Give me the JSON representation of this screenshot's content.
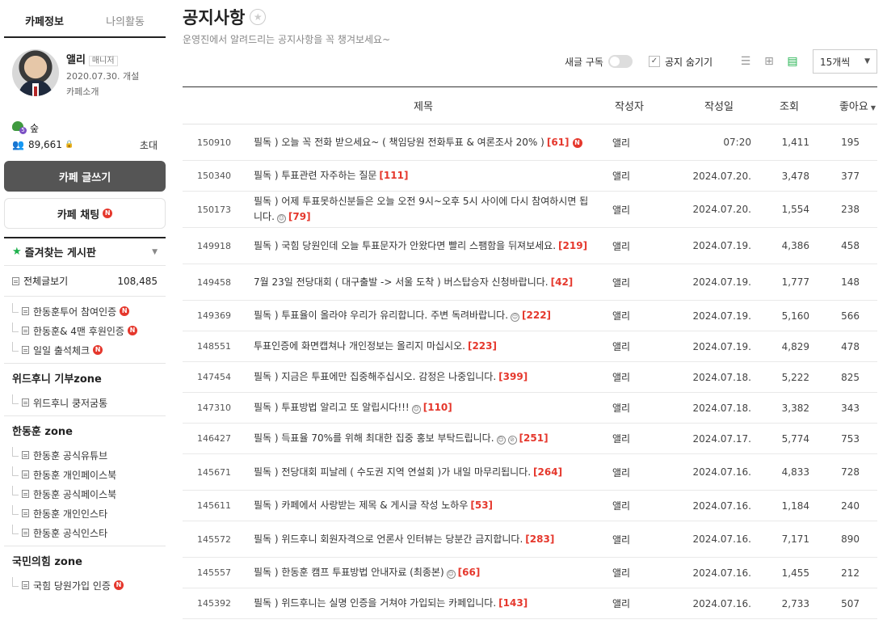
{
  "sidebar": {
    "tabs": [
      "카페정보",
      "나의활동"
    ],
    "profile": {
      "name": "앨리",
      "role": "매니저",
      "since": "2020.07.30. 개설",
      "intro": "카페소개"
    },
    "rank": "숲",
    "members": "89,661",
    "invite": "초대",
    "write_button": "카페 글쓰기",
    "chat_button": "카페 채팅",
    "new_badge": "N",
    "favorites_title": "즐겨찾는 게시판",
    "all_posts": {
      "label": "전체글보기",
      "count": "108,485"
    },
    "group1": [
      "한동훈투어 참여인증",
      "한동훈& 4맨 후원인증",
      "일일 출석체크"
    ],
    "zone1": {
      "title": "위드후니 기부zone",
      "items": [
        "위드후니 쿵저굼통"
      ]
    },
    "zone2": {
      "title": "한동훈 zone",
      "items": [
        "한동훈 공식유튜브",
        "한동훈 개인페이스북",
        "한동훈 공식페이스북",
        "한동훈 개인인스타",
        "한동훈 공식인스타"
      ]
    },
    "zone3": {
      "title": "국민의힘 zone",
      "items": [
        "국힘 당원가입 인증"
      ]
    }
  },
  "main": {
    "title": "공지사항",
    "title_star": "★",
    "description": "운영진에서 알려드리는 공지사항을 꼭 챙겨보세요~",
    "subscribe_label": "새글 구독",
    "hide_notice_label": "공지 숨기기",
    "per_page": "15개씩"
  },
  "table": {
    "headers": {
      "title": "제목",
      "author": "작성자",
      "date": "작성일",
      "views": "조회",
      "likes": "좋아요"
    },
    "rows": [
      {
        "id": "150910",
        "title": "필독 ) 오늘 꼭 전화 받으세요~ ( 책임당원 전화투표 & 여론조사 20% )",
        "comments": "[61]",
        "new": "N",
        "author": "앨리",
        "date": "07:20",
        "views": "1,411",
        "likes": "195"
      },
      {
        "id": "150340",
        "title": "필독 ) 투표관련 자주하는 질문",
        "comments": "[111]",
        "author": "앨리",
        "date": "2024.07.20.",
        "views": "3,478",
        "likes": "377"
      },
      {
        "id": "150173",
        "title": "필독 ) 어제 투표못하신분들은 오늘 오전 9시~오후 5시 사이에 다시 참여하시면 됩니다.",
        "comments": "[79]",
        "emoticon": "☺",
        "author": "앨리",
        "date": "2024.07.20.",
        "views": "1,554",
        "likes": "238"
      },
      {
        "id": "149918",
        "title": "필독 ) 국힘 당원인데 오늘 투표문자가 안왔다면 빨리 스팸함을 뒤져보세요.",
        "comments": "[219]",
        "author": "앨리",
        "date": "2024.07.19.",
        "views": "4,386",
        "likes": "458"
      },
      {
        "id": "149458",
        "title": "7월 23일 전당대회 ( 대구출발 -> 서울 도착 ) 버스탑승자 신청바랍니다.",
        "comments": "[42]",
        "author": "앨리",
        "date": "2024.07.19.",
        "views": "1,777",
        "likes": "148"
      },
      {
        "id": "149369",
        "title": "필독 ) 투표율이 올라야 우리가 유리합니다. 주변 독려바랍니다.",
        "comments": "[222]",
        "emoticon": "☺",
        "author": "앨리",
        "date": "2024.07.19.",
        "views": "5,160",
        "likes": "566"
      },
      {
        "id": "148551",
        "title": "투표인증에 화면캡쳐나 개인정보는 올리지 마십시오.",
        "comments": "[223]",
        "author": "앨리",
        "date": "2024.07.19.",
        "views": "4,829",
        "likes": "478"
      },
      {
        "id": "147454",
        "title": "필독 ) 지금은 투표에만 집중해주십시오. 감정은 나중입니다.",
        "comments": "[399]",
        "author": "앨리",
        "date": "2024.07.18.",
        "views": "5,222",
        "likes": "825"
      },
      {
        "id": "147310",
        "title": "필독 ) 투표방법 알리고 또 알립시다!!!",
        "comments": "[110]",
        "emoticon": "☺",
        "author": "앨리",
        "date": "2024.07.18.",
        "views": "3,382",
        "likes": "343"
      },
      {
        "id": "146427",
        "title": "필독 ) 득표율 70%를 위해 최대한 집중 홍보 부탁드립니다.",
        "comments": "[251]",
        "emoticon": "☺",
        "emoticon2": "⊘",
        "author": "앨리",
        "date": "2024.07.17.",
        "views": "5,774",
        "likes": "753"
      },
      {
        "id": "145671",
        "title": "필독 ) 전당대회 피날레 ( 수도권 지역 연설회 )가 내일 마무리됩니다.",
        "comments": "[264]",
        "author": "앨리",
        "date": "2024.07.16.",
        "views": "4,833",
        "likes": "728"
      },
      {
        "id": "145611",
        "title": "필독 ) 카페에서 사랑받는 제목 & 게시글 작성 노하우",
        "comments": "[53]",
        "author": "앨리",
        "date": "2024.07.16.",
        "views": "1,184",
        "likes": "240"
      },
      {
        "id": "145572",
        "title": "필독 ) 위드후니 회원자격으로 언론사 인터뷰는 당분간 금지합니다.",
        "comments": "[283]",
        "author": "앨리",
        "date": "2024.07.16.",
        "views": "7,171",
        "likes": "890"
      },
      {
        "id": "145557",
        "title": "필독 ) 한동훈 캠프 투표방법 안내자료 (최종본)",
        "comments": "[66]",
        "emoticon": "☺",
        "author": "앨리",
        "date": "2024.07.16.",
        "views": "1,455",
        "likes": "212"
      },
      {
        "id": "145392",
        "title": "필독 ) 위드후니는 실명 인증을 거쳐야 가입되는 카페입니다.",
        "comments": "[143]",
        "author": "앨리",
        "date": "2024.07.16.",
        "views": "2,733",
        "likes": "507"
      }
    ]
  },
  "icons": [
    "star-icon",
    "people-icon",
    "lock-icon",
    "doc-icon",
    "list-view-icon",
    "grid-view-icon",
    "card-view-icon",
    "chevron-down-icon",
    "check-icon",
    "emoticon-icon"
  ],
  "colors": {
    "accent": "#1fb14d",
    "new_badge": "#e5372c",
    "comment_count": "#e5372c",
    "write_button": "#555555"
  }
}
